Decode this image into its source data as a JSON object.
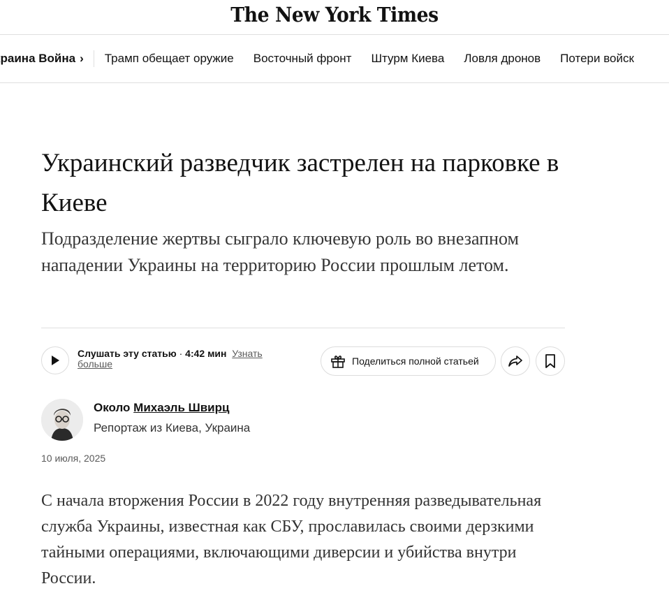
{
  "masthead": {
    "logo": "The New York Times"
  },
  "nav": {
    "main_label": "краина Война",
    "chevron": "›",
    "items": [
      {
        "label": "Трамп обещает оружие"
      },
      {
        "label": "Восточный фронт"
      },
      {
        "label": "Штурм Киева"
      },
      {
        "label": "Ловля дронов"
      },
      {
        "label": "Потери войск"
      }
    ]
  },
  "article": {
    "headline": "Украинский разведчик застрелен на парковке в Киеве",
    "summary": "Подразделение жертвы сыграло ключевую роль во внезапном нападении Украины на территорию России прошлым летом.",
    "audio": {
      "label": "Слушать эту статью",
      "separator": " · ",
      "duration": "4:42 мин",
      "learn_more": "Узнать больше"
    },
    "share_label": "Поделиться полной статьей",
    "byline": {
      "prefix": "Около",
      "author": "Михаэль Швирц",
      "dateline": "Репортаж из Киева, Украина"
    },
    "date": "10 июля, 2025",
    "body": "С начала вторжения России в 2022 году внутренняя разведывательная служба Украины, известная как СБУ, прославилась своими дерзкими тайными операциями, включающими диверсии и убийства внутри России."
  },
  "icons": {
    "play": "play-icon",
    "gift": "gift-icon",
    "share": "share-arrow-icon",
    "bookmark": "bookmark-icon"
  }
}
